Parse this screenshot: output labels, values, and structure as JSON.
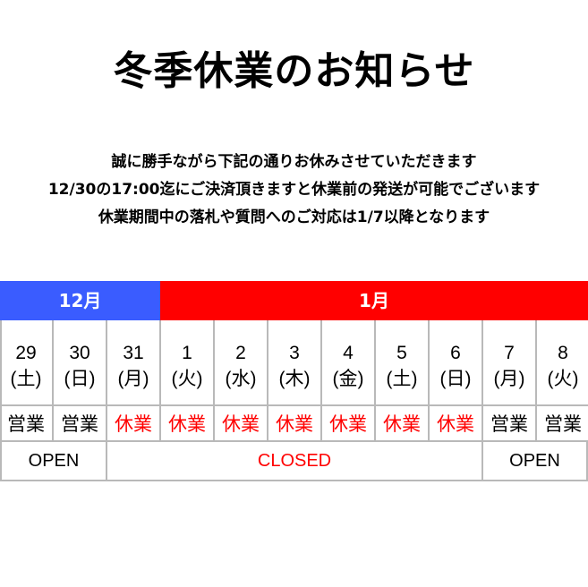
{
  "title": "冬季休業のお知らせ",
  "notice": {
    "line1": "誠に勝手ながら下記の通りお休みさせていただきます",
    "line2": "12/30の17:00迄にご決済頂きますと休業前の発送が可能でございます",
    "line3": "休業期間中の落札や質問へのご対応は1/7以降となります"
  },
  "colors": {
    "december": "#3a5cff",
    "january": "#ff0000",
    "closed_text": "#ff0000",
    "open_text": "#000000",
    "grid_line": "#b9b9b9"
  },
  "months": {
    "december": "12月",
    "january": "1月"
  },
  "days": [
    {
      "date": "29",
      "weekday": "(土)",
      "status": "営業",
      "state": "open"
    },
    {
      "date": "30",
      "weekday": "(日)",
      "status": "営業",
      "state": "open"
    },
    {
      "date": "31",
      "weekday": "(月)",
      "status": "休業",
      "state": "closed"
    },
    {
      "date": "1",
      "weekday": "(火)",
      "status": "休業",
      "state": "closed"
    },
    {
      "date": "2",
      "weekday": "(水)",
      "status": "休業",
      "state": "closed"
    },
    {
      "date": "3",
      "weekday": "(木)",
      "status": "休業",
      "state": "closed"
    },
    {
      "date": "4",
      "weekday": "(金)",
      "status": "休業",
      "state": "closed"
    },
    {
      "date": "5",
      "weekday": "(土)",
      "status": "休業",
      "state": "closed"
    },
    {
      "date": "6",
      "weekday": "(日)",
      "status": "休業",
      "state": "closed"
    },
    {
      "date": "7",
      "weekday": "(月)",
      "status": "営業",
      "state": "open"
    },
    {
      "date": "8",
      "weekday": "(火)",
      "status": "営業",
      "state": "open"
    }
  ],
  "ranges": {
    "open_before": "OPEN",
    "closed": "CLOSED",
    "open_after": "OPEN"
  }
}
